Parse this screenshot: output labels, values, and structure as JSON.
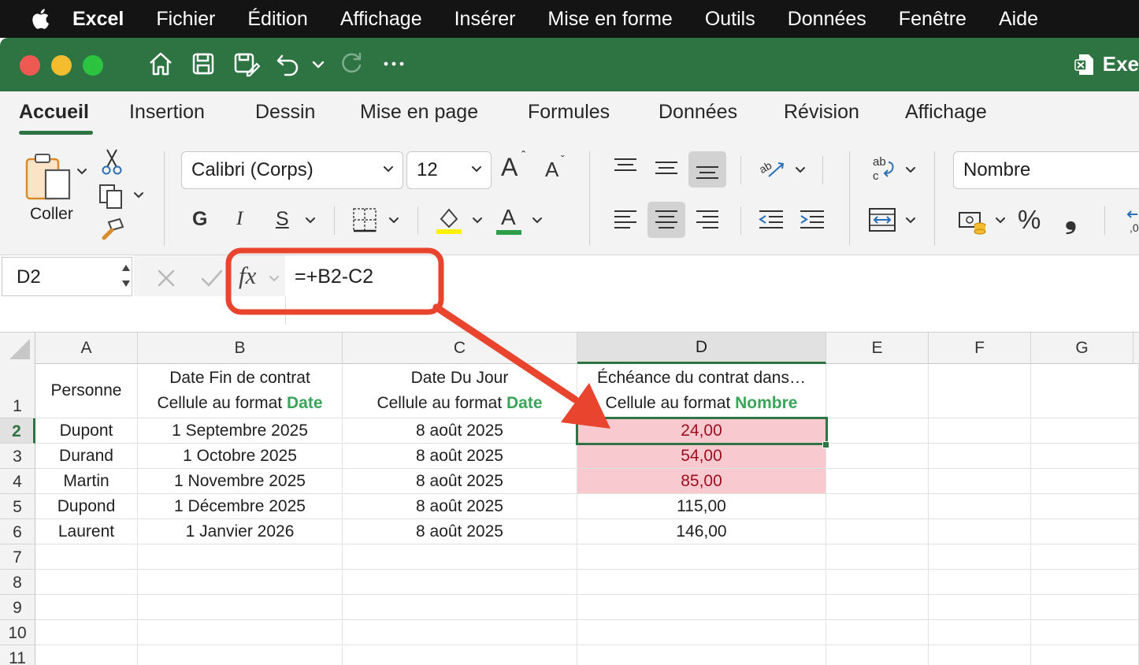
{
  "menubar": {
    "app": "Excel",
    "items": [
      "Fichier",
      "Édition",
      "Affichage",
      "Insérer",
      "Mise en forme",
      "Outils",
      "Données",
      "Fenêtre",
      "Aide"
    ]
  },
  "titlebar": {
    "app_title": "Exe"
  },
  "ribbon_tabs": [
    "Accueil",
    "Insertion",
    "Dessin",
    "Mise en page",
    "Formules",
    "Données",
    "Révision",
    "Affichage"
  ],
  "ribbon": {
    "paste_label": "Coller",
    "font_name": "Calibri (Corps)",
    "font_size": "12",
    "bold_label": "G",
    "italic_label": "I",
    "underline_label": "S",
    "number_format": "Nombre",
    "percent_label": "%",
    "comma_label": "❟",
    "grow_font": "A",
    "shrink_font": "A",
    "font_color_letter": "A"
  },
  "formula_bar": {
    "name_box": "D2",
    "fx_label": "fx",
    "formula": "=+B2-C2"
  },
  "grid": {
    "columns": [
      "A",
      "B",
      "C",
      "D",
      "E",
      "F",
      "G"
    ],
    "active_column": "D",
    "active_row": "2",
    "row_numbers": [
      "1",
      "2",
      "3",
      "4",
      "5",
      "6",
      "7",
      "8",
      "9",
      "10",
      "11"
    ],
    "header_row": {
      "a": "Personne",
      "b_line1": "Date Fin de contrat",
      "b_line2_prefix": "Cellule au format ",
      "b_line2_highlight": "Date",
      "c_line1": "Date Du Jour",
      "c_line2_prefix": "Cellule au format ",
      "c_line2_highlight": "Date",
      "d_line1": "Échéance du contrat dans…",
      "d_line2_prefix": "Cellule au format ",
      "d_line2_highlight": "Nombre"
    },
    "rows": [
      {
        "a": "Dupont",
        "b": "1 Septembre 2025",
        "c": "8 août 2025",
        "d": "24,00"
      },
      {
        "a": "Durand",
        "b": "1 Octobre 2025",
        "c": "8 août 2025",
        "d": "54,00"
      },
      {
        "a": "Martin",
        "b": "1 Novembre 2025",
        "c": "8 août 2025",
        "d": "85,00"
      },
      {
        "a": "Dupond",
        "b": "1 Décembre 2025",
        "c": "8 août 2025",
        "d": "115,00"
      },
      {
        "a": "Laurent",
        "b": "1 Janvier 2026",
        "c": "8 août 2025",
        "d": "146,00"
      }
    ]
  },
  "colors": {
    "excel_green": "#2e7442",
    "highlight_pink": "#f8c9cf",
    "highlight_text": "#9c0d1d",
    "annotation_red": "#e8442e",
    "green_word": "#3aa55a"
  }
}
